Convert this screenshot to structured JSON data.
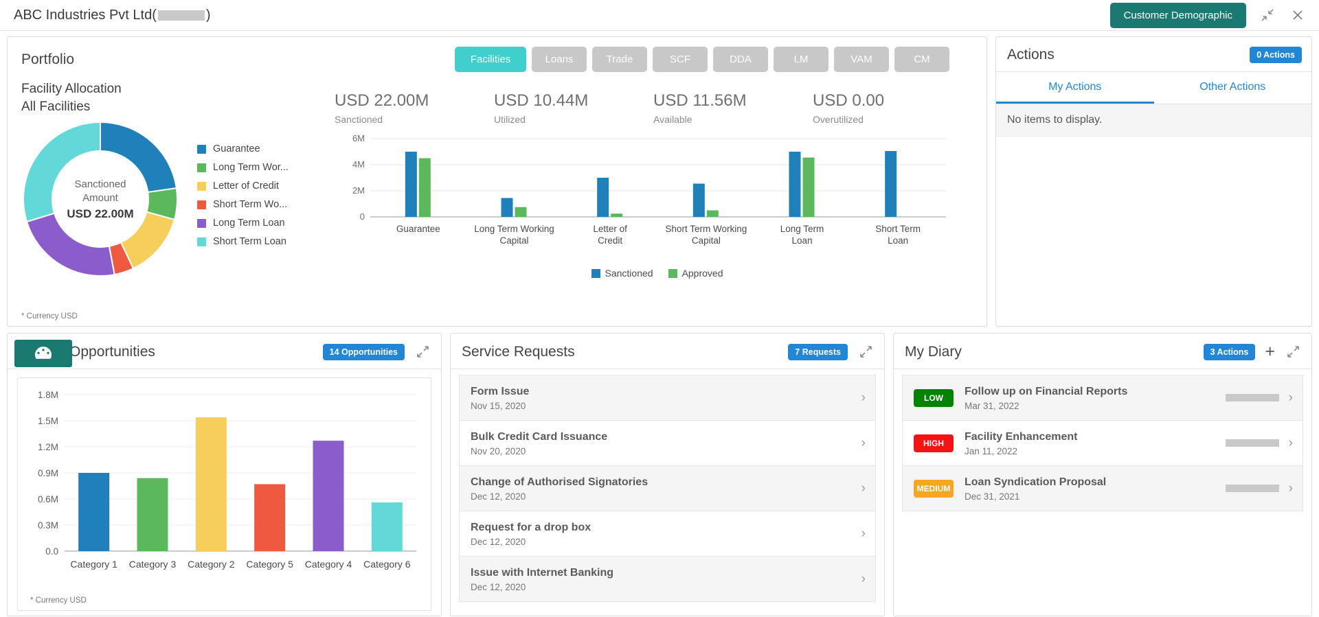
{
  "titlebar": {
    "company": "ABC Industries Pvt Ltd(",
    "company_close": ")",
    "demographic_button": "Customer Demographic",
    "collapse_icon": "collapse-arrows-icon",
    "close_icon": "close-icon"
  },
  "portfolio": {
    "title": "Portfolio",
    "tabs": [
      {
        "label": "Facilities",
        "active": true
      },
      {
        "label": "Loans",
        "active": false
      },
      {
        "label": "Trade",
        "active": false
      },
      {
        "label": "SCF",
        "active": false
      },
      {
        "label": "DDA",
        "active": false
      },
      {
        "label": "LM",
        "active": false
      },
      {
        "label": "VAM",
        "active": false
      },
      {
        "label": "CM",
        "active": false
      }
    ],
    "allocation_title": "Facility Allocation",
    "allocation_subtitle": "All Facilities",
    "donut_center": {
      "line1": "Sanctioned",
      "line2": "Amount",
      "line3": "USD 22.00M"
    },
    "footnote": "* Currency USD",
    "kpis": [
      {
        "value": "USD 22.00M",
        "label": "Sanctioned"
      },
      {
        "value": "USD 10.44M",
        "label": "Utilized"
      },
      {
        "value": "USD 11.56M",
        "label": "Available"
      },
      {
        "value": "USD 0.00",
        "label": "Overutilized"
      }
    ]
  },
  "chart_data": [
    {
      "type": "pie",
      "title": "Facility Allocation",
      "subtitle": "All Facilities",
      "center_label": "Sanctioned Amount USD 22.00M",
      "legend_position": "right",
      "labels": [
        "Guarantee",
        "Long Term Wor...",
        "Letter of Credit",
        "Short Term Wo...",
        "Long Term Loan",
        "Short Term Loan"
      ],
      "full_labels": [
        "Guarantee",
        "Long Term Working Capital",
        "Letter of Credit",
        "Short Term Working Capital",
        "Long Term Loan",
        "Short Term Loan"
      ],
      "values": [
        5.0,
        1.45,
        3.0,
        0.9,
        5.1,
        6.55
      ],
      "colors": [
        "#2080b9",
        "#5cb85c",
        "#f7ce5b",
        "#ee5a3f",
        "#8a5ccc",
        "#63d8d8"
      ],
      "unit": "M USD",
      "total": 22.0
    },
    {
      "type": "bar",
      "title": "",
      "categories": [
        "Guarantee",
        "Long Term Working Capital",
        "Letter of Credit",
        "Short Term Working Capital",
        "Long Term Loan",
        "Short Term Loan"
      ],
      "series": [
        {
          "name": "Sanctioned",
          "color": "#2080b9",
          "values": [
            5.0,
            1.45,
            3.0,
            2.55,
            5.0,
            5.05
          ]
        },
        {
          "name": "Approved",
          "color": "#5cb85c",
          "values": [
            4.5,
            0.75,
            0.25,
            0.5,
            4.55,
            0.0
          ]
        }
      ],
      "ylabel": "",
      "xlabel": "",
      "ylim": [
        0,
        6
      ],
      "yticks": [
        "0",
        "2M",
        "4M",
        "6M"
      ],
      "ytick_values": [
        0,
        2,
        4,
        6
      ],
      "grid": true,
      "legend_position": "bottom"
    },
    {
      "type": "bar",
      "title": "Opportunities",
      "categories": [
        "Category 1",
        "Category 3",
        "Category 2",
        "Category 5",
        "Category 4",
        "Category 6"
      ],
      "values": [
        0.9,
        0.84,
        1.54,
        0.77,
        1.27,
        0.56
      ],
      "colors": [
        "#2080b9",
        "#5cb85c",
        "#f7ce5b",
        "#ee5a3f",
        "#8a5ccc",
        "#63d8d8"
      ],
      "ylabel": "",
      "xlabel": "",
      "ylim": [
        0,
        1.8
      ],
      "yticks": [
        "0.0",
        "0.3M",
        "0.6M",
        "0.9M",
        "1.2M",
        "1.5M",
        "1.8M"
      ],
      "ytick_values": [
        0,
        0.3,
        0.6,
        0.9,
        1.2,
        1.5,
        1.8
      ],
      "grid": true,
      "footnote": "* Currency USD"
    }
  ],
  "actions": {
    "title": "Actions",
    "badge": "0 Actions",
    "tabs": [
      {
        "label": "My Actions",
        "active": true
      },
      {
        "label": "Other Actions",
        "active": false
      }
    ],
    "empty_message": "No items to display."
  },
  "opportunities": {
    "title": "Opportunities",
    "badge": "14 Opportunities",
    "icon": "gauge-icon",
    "expand_icon": "expand-arrows-icon",
    "footnote": "* Currency USD"
  },
  "service_requests": {
    "title": "Service Requests",
    "badge": "7 Requests",
    "expand_icon": "expand-arrows-icon",
    "items": [
      {
        "title": "Form Issue",
        "date": "Nov 15, 2020"
      },
      {
        "title": "Bulk Credit Card Issuance",
        "date": "Nov 20, 2020"
      },
      {
        "title": "Change of Authorised Signatories",
        "date": "Dec 12, 2020"
      },
      {
        "title": "Request for a drop box",
        "date": "Dec 12, 2020"
      },
      {
        "title": "Issue with Internet Banking",
        "date": "Dec 12, 2020"
      }
    ]
  },
  "my_diary": {
    "title": "My Diary",
    "badge": "3 Actions",
    "add_icon": "plus-icon",
    "expand_icon": "expand-arrows-icon",
    "items": [
      {
        "priority": "LOW",
        "priority_color": "#068206",
        "title": "Follow up on Financial Reports",
        "date": "Mar 31, 2022"
      },
      {
        "priority": "HIGH",
        "priority_color": "#f41414",
        "title": "Facility Enhancement",
        "date": "Jan 11, 2022"
      },
      {
        "priority": "MEDIUM",
        "priority_color": "#f5a623",
        "title": "Loan Syndication Proposal",
        "date": "Dec 31, 2021"
      }
    ]
  },
  "colors": {
    "accent_teal": "#1a7a72",
    "accent_blue": "#2186d6",
    "tab_active": "#41cfce",
    "tab_inactive": "#c8c8c8"
  }
}
